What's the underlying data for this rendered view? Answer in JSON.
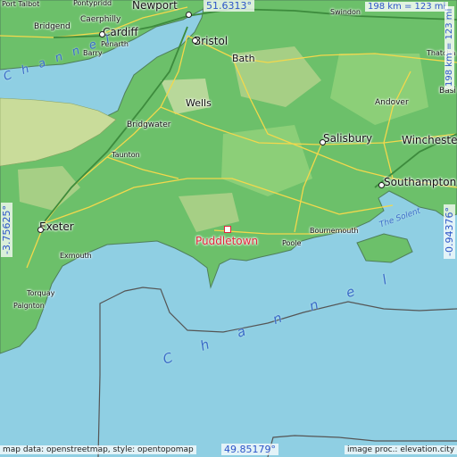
{
  "highlight": {
    "name": "Puddletown"
  },
  "coordinates": {
    "top": "51.6313°",
    "bottom": "49.85179°",
    "left": "-3.75625°",
    "right": "-0.94376°"
  },
  "scale": {
    "label": "198 km = 123 mi"
  },
  "places": {
    "port_talbot": "Port Talbot",
    "pontypridd": "Pontypridd",
    "newport": "Newport",
    "swindon": "Swindon",
    "caerphilly": "Caerphilly",
    "bridgend": "Bridgend",
    "cardiff": "Cardiff",
    "penarth": "Penarth",
    "barry": "Barry",
    "bristol": "Bristol",
    "bath": "Bath",
    "thatcham": "Thatcha",
    "basingstoke": "Basi",
    "wells": "Wells",
    "andover": "Andover",
    "bridgwater": "Bridgwater",
    "salisbury": "Salisbury",
    "winchester": "Wincheste",
    "taunton": "Taunton",
    "southampton": "Southampton",
    "exeter": "Exeter",
    "bournemouth": "Bournemouth",
    "poole": "Poole",
    "exmouth": "Exmouth",
    "torquay": "Torquay",
    "paignton": "Paignton"
  },
  "water": {
    "channel_north": "Channel",
    "channel_south": "Channel",
    "solent": "The Solent"
  },
  "credits": {
    "left": "map data: openstreetmap, style: opentopomap",
    "right": "image proc.: elevation.city"
  },
  "colors": {
    "sea": "#8fcfe3",
    "lowland": "#6cc06a",
    "upland": "#c9dc9a",
    "highlight": "#e2243a",
    "coord_text": "#2c55c8"
  }
}
